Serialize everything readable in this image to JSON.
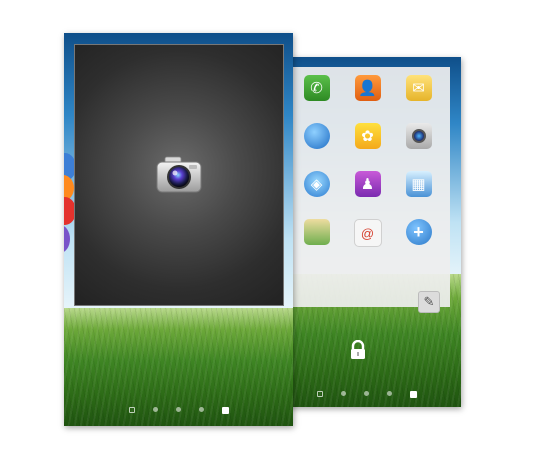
{
  "back_screen": {
    "apps": [
      {
        "name": "phone-app-icon",
        "glyph": "✆",
        "kind": "phone"
      },
      {
        "name": "contacts-app-icon",
        "glyph": "👤",
        "kind": "contacts"
      },
      {
        "name": "email-app-icon",
        "glyph": "✉",
        "kind": "email"
      },
      {
        "name": "internet-app-icon",
        "glyph": "",
        "kind": "internet"
      },
      {
        "name": "gallery-app-icon",
        "glyph": "✿",
        "kind": "gallery"
      },
      {
        "name": "camera-app-icon",
        "glyph": "",
        "kind": "camera"
      },
      {
        "name": "apps-app-icon",
        "glyph": "◈",
        "kind": "apps"
      },
      {
        "name": "store-app-icon",
        "glyph": "♟",
        "kind": "store"
      },
      {
        "name": "photo-app-icon",
        "glyph": "▦",
        "kind": "photo"
      },
      {
        "name": "maps-app-icon",
        "glyph": "",
        "kind": "maps"
      },
      {
        "name": "gmail-app-icon",
        "glyph": "@",
        "kind": "gmail"
      },
      {
        "name": "add-app-icon",
        "glyph": "+",
        "kind": "add"
      }
    ],
    "page_indicator": {
      "pages": 5,
      "active_index": 4
    },
    "icons": [
      "pencil-icon",
      "lock-icon"
    ]
  },
  "front_screen": {
    "widget_icon": "camera-icon",
    "page_indicator": {
      "pages": 5,
      "active_index": 4
    }
  },
  "colors": {
    "widget_bg": "#3a3a3a",
    "panel_bg": "#eeeeee",
    "sky": "#2f86c6",
    "grass": "#3e8523"
  }
}
